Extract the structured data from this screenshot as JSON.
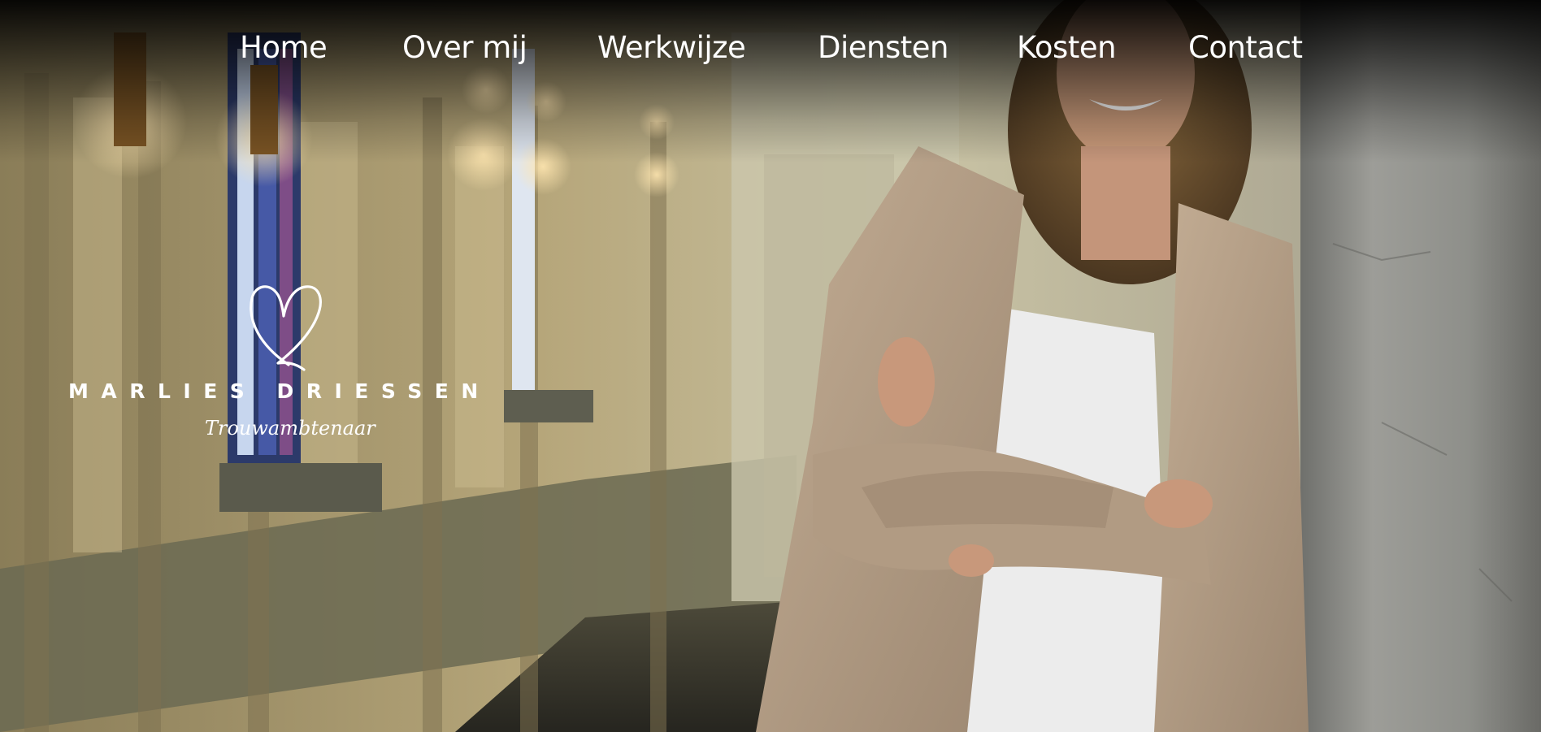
{
  "nav": {
    "items": [
      {
        "label": "Home"
      },
      {
        "label": "Over mij"
      },
      {
        "label": "Werkwijze"
      },
      {
        "label": "Diensten"
      },
      {
        "label": "Kosten"
      },
      {
        "label": "Contact"
      }
    ]
  },
  "logo": {
    "name": "MARLIES DRIESSEN",
    "tagline": "Trouwambtenaar",
    "icon": "heart-icon"
  },
  "hero": {
    "photo": "woman-leaning-on-pillar-in-church-hallway"
  },
  "colors": {
    "nav_text": "#ffffff",
    "wall": "#b9ad86",
    "blazer": "#b6a18a",
    "pillar": "#8d8d88"
  }
}
